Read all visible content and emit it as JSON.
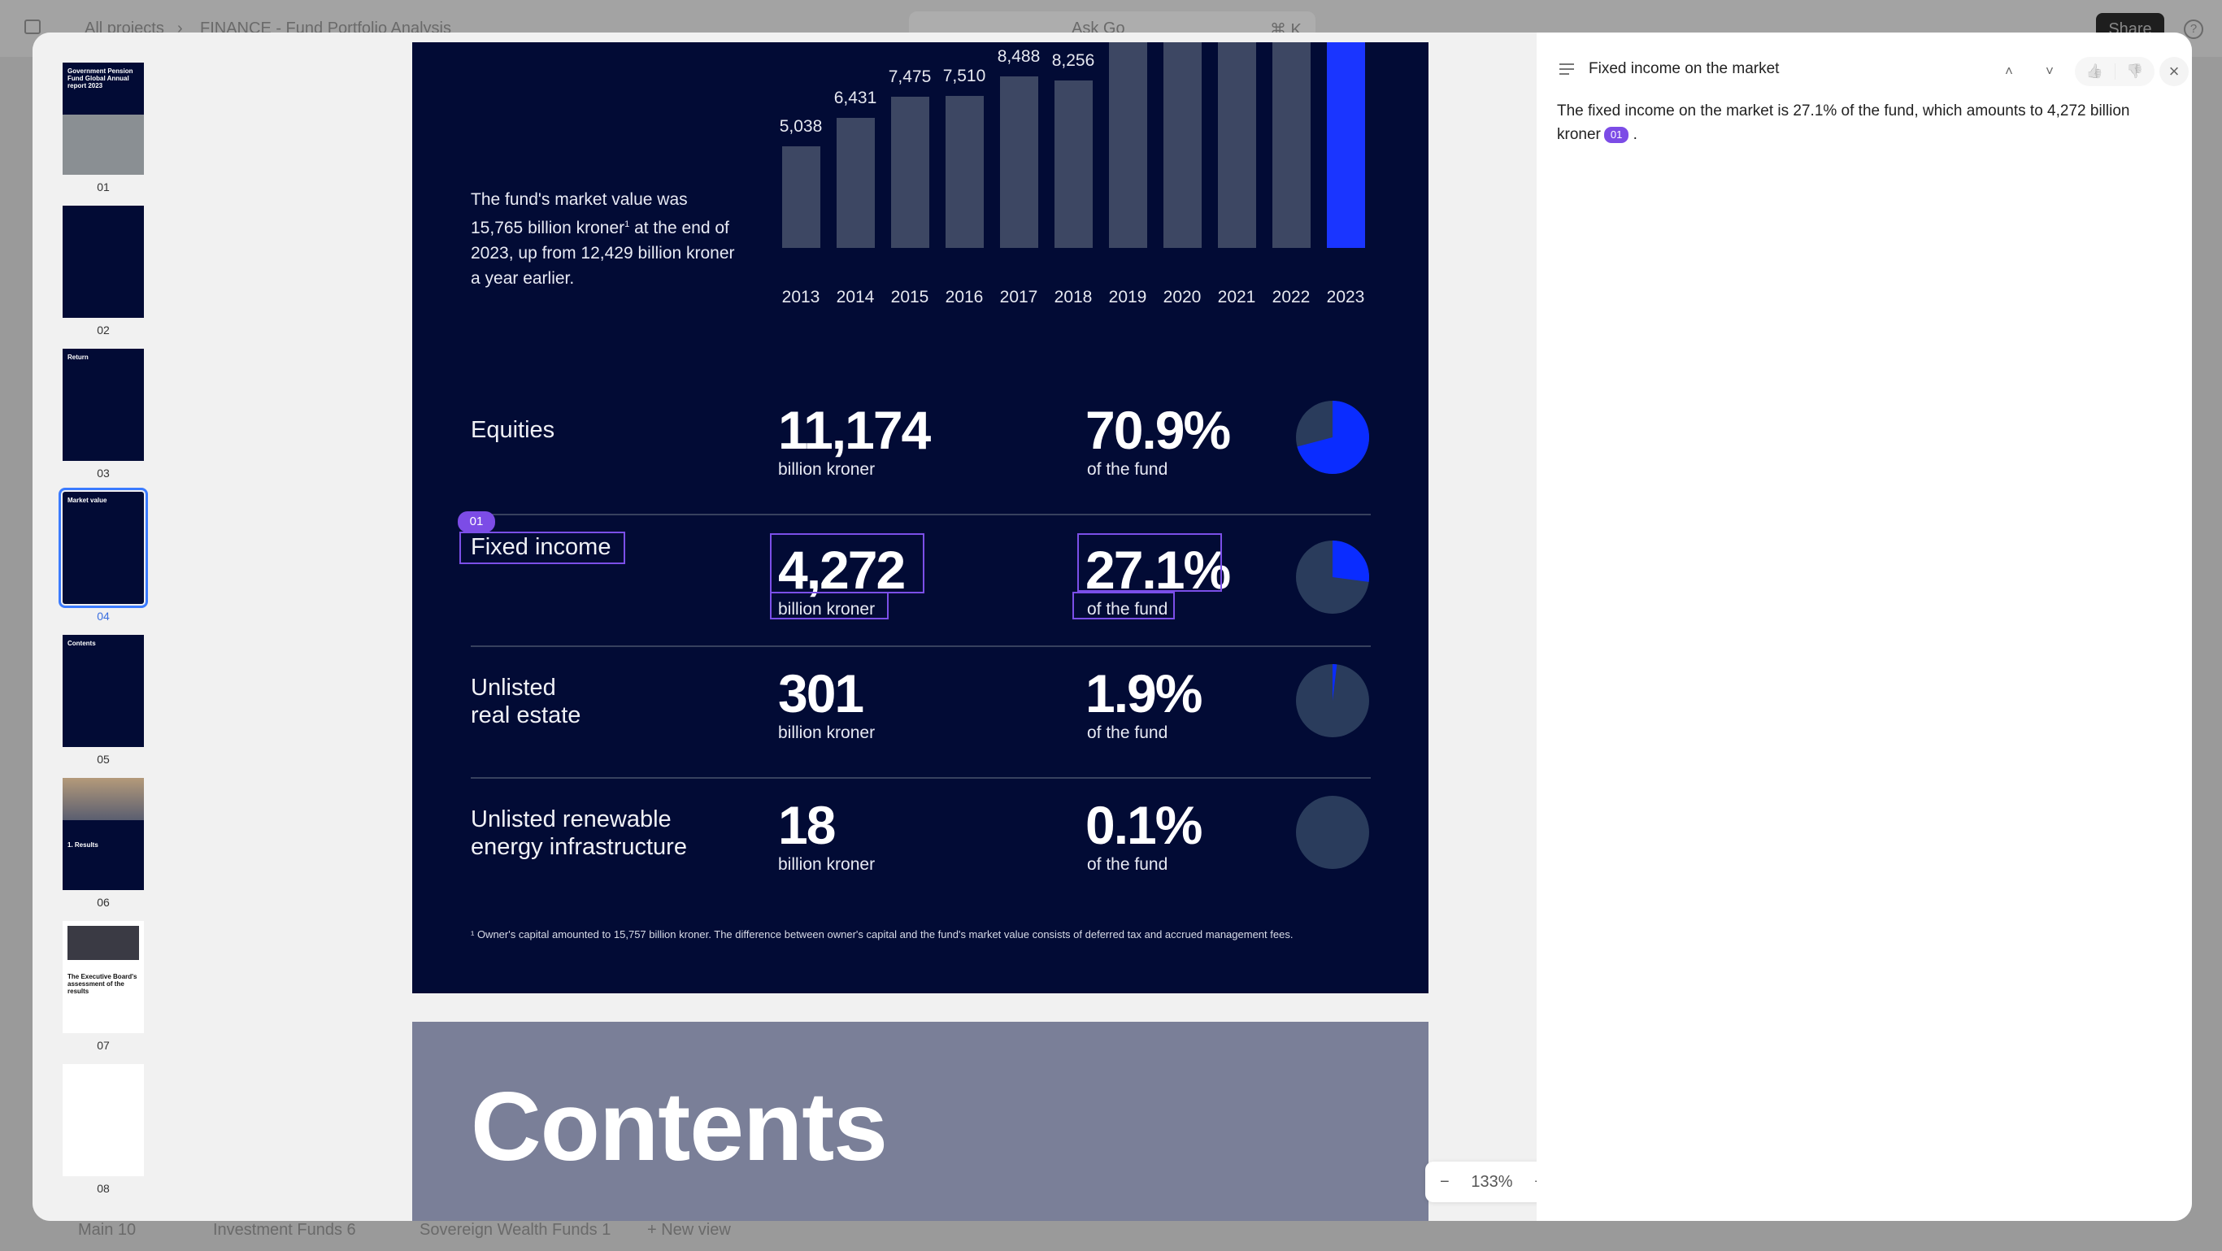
{
  "topbar": {
    "breadcrumb": [
      "All projects",
      "FINANCE - Fund Portfolio Analysis"
    ],
    "breadcrumb_sep": "›",
    "search_label": "Ask Go",
    "search_shortcut": "⌘ K",
    "share_label": "Share",
    "help_icon": "?"
  },
  "bottombar": {
    "views": [
      {
        "label": "Main",
        "count": "10"
      },
      {
        "label": "Investment Funds",
        "count": "6"
      },
      {
        "label": "Sovereign Wealth Funds",
        "count": "1"
      }
    ],
    "new_view": "+ New view"
  },
  "thumbnails": [
    {
      "num": "01",
      "title": "Government Pension Fund Global Annual report 2023"
    },
    {
      "num": "02",
      "title": ""
    },
    {
      "num": "03",
      "title": "Return"
    },
    {
      "num": "04",
      "title": "Market value",
      "selected": true
    },
    {
      "num": "05",
      "title": "Contents"
    },
    {
      "num": "06",
      "title": "1. Results"
    },
    {
      "num": "07",
      "title": "The Executive Board's assessment of the results"
    },
    {
      "num": "08",
      "title": ""
    }
  ],
  "page": {
    "intro": [
      "The fund's market value was",
      "15,765 billion kroner",
      "1",
      " at the end of 2023, up from 12,429 billion kroner a year earlier."
    ],
    "rows": [
      {
        "label": "Equities",
        "value": "11,174",
        "unit": "billion kroner",
        "pct": "70.9%",
        "pct_unit": "of the fund",
        "share": 70.9
      },
      {
        "label": "Fixed income",
        "value": "4,272",
        "unit": "billion kroner",
        "pct": "27.1%",
        "pct_unit": "of the fund",
        "share": 27.1
      },
      {
        "label": "Unlisted\nreal estate",
        "value": "301",
        "unit": "billion kroner",
        "pct": "1.9%",
        "pct_unit": "of the fund",
        "share": 1.9
      },
      {
        "label": "Unlisted renewable\nenergy infrastructure",
        "value": "18",
        "unit": "billion kroner",
        "pct": "0.1%",
        "pct_unit": "of the fund",
        "share": 0.1
      }
    ],
    "highlight_badge": "01",
    "footnote": "¹ Owner's capital amounted to 15,757 billion kroner. The difference between owner's capital and the fund's market value consists of deferred tax and accrued management fees.",
    "next_page_title": "Contents"
  },
  "chart_data": {
    "type": "bar",
    "categories": [
      "2013",
      "2014",
      "2015",
      "2016",
      "2017",
      "2018",
      "2019",
      "2020",
      "2021",
      "2022",
      "2023"
    ],
    "values": [
      5038,
      6431,
      7475,
      7510,
      8488,
      8256,
      null,
      null,
      null,
      12429,
      15765
    ],
    "labels": [
      "5,038",
      "6,431",
      "7,475",
      "7,510",
      "8,488",
      "8,256",
      "",
      "",
      "",
      "",
      ""
    ],
    "highlight": "2023",
    "colors": {
      "bar": "#3d4763",
      "highlight": "#1a35ff"
    }
  },
  "pie_colors": {
    "share": "#0a2cff",
    "rest": "#2a3c5c"
  },
  "zoom": {
    "minus": "−",
    "level": "133%",
    "plus": "+"
  },
  "panel": {
    "title": "Fixed income on the market",
    "text": "The fixed income on the market is 27.1% of the fund, which amounts to 4,272 billion kroner",
    "badge": "01",
    "up": "˄",
    "down": "˅",
    "like": "👍",
    "dislike": "👎",
    "close": "×"
  }
}
